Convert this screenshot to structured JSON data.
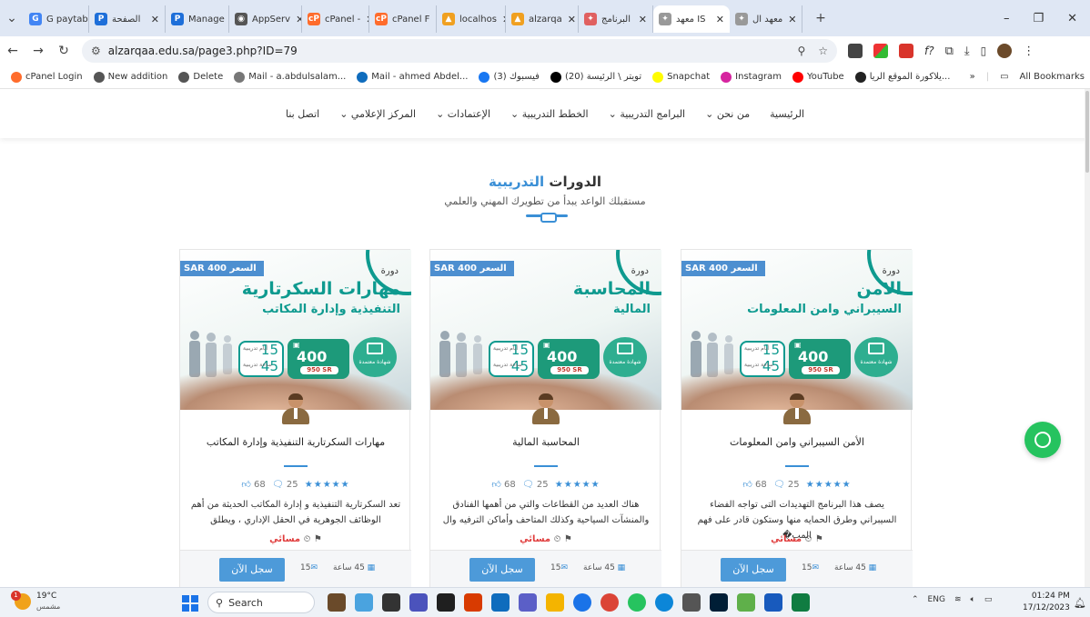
{
  "browser": {
    "tabs": [
      {
        "label": "G  paytabs",
        "icon": "google-icon",
        "color": "#4285f4",
        "glyph": "G"
      },
      {
        "label": "الصفحة",
        "icon": "page-icon",
        "color": "#1e6fd9",
        "glyph": "P"
      },
      {
        "label": "Manage",
        "icon": "page-icon",
        "color": "#1e6fd9",
        "glyph": "P"
      },
      {
        "label": "AppServ",
        "icon": "globe-icon",
        "color": "#555555",
        "glyph": "◉"
      },
      {
        "label": "cPanel -",
        "icon": "cpanel-icon",
        "color": "#ff6c2c",
        "glyph": "cP"
      },
      {
        "label": "cPanel F",
        "icon": "cpanel-icon",
        "color": "#ff6c2c",
        "glyph": "cP"
      },
      {
        "label": "localhos",
        "icon": "phpmyadmin-icon",
        "color": "#f0a020",
        "glyph": "▲"
      },
      {
        "label": "alzarqa",
        "icon": "phpmyadmin-icon",
        "color": "#f0a020",
        "glyph": "▲"
      },
      {
        "label": "البرنامج",
        "icon": "site-icon",
        "color": "#e06060",
        "glyph": "✦"
      },
      {
        "label": "معهد IS",
        "icon": "site-icon",
        "color": "#999999",
        "glyph": "✦"
      },
      {
        "label": "معهد ال",
        "icon": "site-icon",
        "color": "#999999",
        "glyph": "✦"
      }
    ],
    "url": "alzarqaa.edu.sa/page3.php?ID=79",
    "bookmarks": [
      {
        "label": "cPanel Login",
        "icon": "cpanel-icon",
        "color": "#ff6c2c"
      },
      {
        "label": "New addition",
        "icon": "globe-icon",
        "color": "#555555"
      },
      {
        "label": "Delete",
        "icon": "globe-icon",
        "color": "#555555"
      },
      {
        "label": "Mail - a.abdulsalam...",
        "icon": "document-icon",
        "color": "#777777"
      },
      {
        "label": "Mail - ahmed Abdel...",
        "icon": "outlook-icon",
        "color": "#0f6cbd"
      },
      {
        "label": "(3) فيسبوك",
        "icon": "facebook-icon",
        "color": "#1877f2"
      },
      {
        "label": "(20) تويتر \\ الرئيسة",
        "icon": "x-icon",
        "color": "#000000"
      },
      {
        "label": "Snapchat",
        "icon": "snapchat-icon",
        "color": "#fffc00"
      },
      {
        "label": "Instagram",
        "icon": "instagram-icon",
        "color": "#d6249f"
      },
      {
        "label": "YouTube",
        "icon": "youtube-icon",
        "color": "#ff0000"
      },
      {
        "label": "يلاكورة الموقع الريا...",
        "icon": "site-icon",
        "color": "#222222"
      }
    ],
    "all_bookmarks": "All Bookmarks"
  },
  "site_nav": [
    "الرئيسية",
    "من نحن",
    "البرامج التدريبية",
    "الخطط التدريبية",
    "الإعتمادات",
    "المركز الإعلامي",
    "اتصل بنا"
  ],
  "section": {
    "title_a": "الدورات",
    "title_b": "التدريبية",
    "subtitle": "مستقبلك الواعد يبدأ من تطويرك المهني والعلمي"
  },
  "cards": [
    {
      "price_tag": "السعر SAR 400",
      "dawra": "دورة",
      "banner_t1": "الامن",
      "banner_t2": "السيبراني وامن المعلومات",
      "days": "15",
      "hours": "45",
      "days_lbl": "أيام تدريبية",
      "hours_lbl": "ساعة تدريبية",
      "price_badge": "400",
      "old_price": "950 SR",
      "cert": "شهادة معتمدة",
      "title": "الأمن السيبراني وامن المعلومات",
      "likes": "68",
      "comments": "25",
      "stars": "★★★★★",
      "desc": "يصف هذا البرنامج التهديدات التى تواجه الفضاء السيبراني وطرق الحمايه منها وستكون قادر على فهم المب�",
      "instructor": "مسائي",
      "button": "سجل الآن",
      "seats": "15",
      "hours_text": "45 ساعة"
    },
    {
      "price_tag": "السعر SAR 400",
      "dawra": "دورة",
      "banner_t1": "المحاسبة",
      "banner_t2": "المالية",
      "days": "15",
      "hours": "45",
      "days_lbl": "أيام تدريبية",
      "hours_lbl": "ساعة تدريبية",
      "price_badge": "400",
      "old_price": "950 SR",
      "cert": "شهادة معتمدة",
      "title": "المحاسبة المالية",
      "likes": "68",
      "comments": "25",
      "stars": "★★★★★",
      "desc": "هناك العديد من القطاعات والتي من أهمها الفنادق والمنشآت السياحية وكذلك المتاحف وأماكن الترفيه وال",
      "instructor": "مسائي",
      "button": "سجل الآن",
      "seats": "15",
      "hours_text": "45 ساعة"
    },
    {
      "price_tag": "السعر SAR 400",
      "dawra": "دورة",
      "banner_t1": "مهارات السكرتارية",
      "banner_t2": "التنفيذية وإدارة المكاتب",
      "days": "15",
      "hours": "45",
      "days_lbl": "أيام تدريبية",
      "hours_lbl": "ساعة تدريبية",
      "price_badge": "400",
      "old_price": "950 SR",
      "cert": "شهادة معتمدة",
      "title": "مهارات السكرتارية التنفيذية وإدارة المكاتب",
      "likes": "68",
      "comments": "25",
      "stars": "★★★★★",
      "desc": "تعد السكرتارية التنفيذية و إدارة المكاتب الحديثة من أهم الوظائف الجوهرية في الحقل الإداري ، ويطلق",
      "instructor": "مسائي",
      "button": "سجل الآن",
      "seats": "15",
      "hours_text": "45 ساعة"
    }
  ],
  "taskbar": {
    "temp": "19°C",
    "weather": "مشمس",
    "weather_badge": "1",
    "search": "Search",
    "lang": "ENG",
    "time": "01:24 PM",
    "date": "17/12/2023"
  },
  "colors": {
    "accent": "#3a8fd6",
    "teal": "#0e9a8f",
    "whatsapp": "#26c35f",
    "instructor": "#e03c3c"
  }
}
